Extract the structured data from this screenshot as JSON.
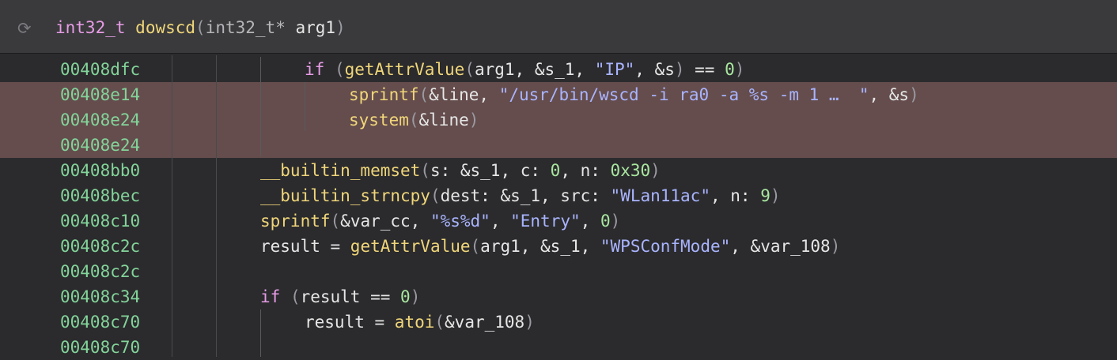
{
  "header": {
    "return_type": "int32_t",
    "func_name": "dowscd",
    "open_paren": "(",
    "param_type": "int32_t*",
    "param_name": "arg1",
    "close_paren": ")",
    "refresh_icon": "⟳"
  },
  "rows": [
    {
      "address": "00408dfc",
      "highlighted": false
    },
    {
      "address": "00408e14",
      "highlighted": true
    },
    {
      "address": "00408e24",
      "highlighted": true
    },
    {
      "address": "00408e24",
      "highlighted": true
    },
    {
      "address": "00408bb0",
      "highlighted": false
    },
    {
      "address": "00408bec",
      "highlighted": false
    },
    {
      "address": "00408c10",
      "highlighted": false
    },
    {
      "address": "00408c2c",
      "highlighted": false
    },
    {
      "address": "00408c2c",
      "highlighted": false
    },
    {
      "address": "00408c34",
      "highlighted": false
    },
    {
      "address": "00408c70",
      "highlighted": false
    },
    {
      "address": "00408c70",
      "highlighted": false
    }
  ],
  "code": {
    "l0": {
      "kw": "if",
      "op": " (",
      "fn": "getAttrValue",
      "p1": "(",
      "a1": "arg1, &s_1, ",
      "s1": "\"IP\"",
      "a2": ", &s",
      "p2": ")",
      "eq": " == ",
      "n": "0",
      "p3": ")"
    },
    "l1": {
      "fn": "sprintf",
      "p1": "(",
      "a1": "&line, ",
      "s1": "\"/usr/bin/wscd -i ra0 -a %s -m 1 …  \"",
      "a2": ", &s",
      "p2": ")"
    },
    "l2": {
      "fn": "system",
      "p1": "(",
      "a1": "&line",
      "p2": ")"
    },
    "l4": {
      "fn": "__builtin_memset",
      "p1": "(",
      "a1": "s: &s_1, c: ",
      "n1": "0",
      "a2": ", n: ",
      "n2": "0x30",
      "p2": ")"
    },
    "l5": {
      "fn": "__builtin_strncpy",
      "p1": "(",
      "a1": "dest: &s_1, src: ",
      "s1": "\"WLan11ac\"",
      "a2": ", n: ",
      "n1": "9",
      "p2": ")"
    },
    "l6": {
      "fn": "sprintf",
      "p1": "(",
      "a1": "&var_cc, ",
      "s1": "\"%s%d\"",
      "a2": ", ",
      "s2": "\"Entry\"",
      "a3": ", ",
      "n1": "0",
      "p2": ")"
    },
    "l7": {
      "a0": "result = ",
      "fn": "getAttrValue",
      "p1": "(",
      "a1": "arg1, &s_1, ",
      "s1": "\"WPSConfMode\"",
      "a2": ", &var_108",
      "p2": ")"
    },
    "l9": {
      "kw": "if",
      "op": " (",
      "a1": "result == ",
      "n1": "0",
      "p2": ")"
    },
    "l10": {
      "a0": "result = ",
      "fn": "atoi",
      "p1": "(",
      "a1": "&var_108",
      "p2": ")"
    }
  }
}
